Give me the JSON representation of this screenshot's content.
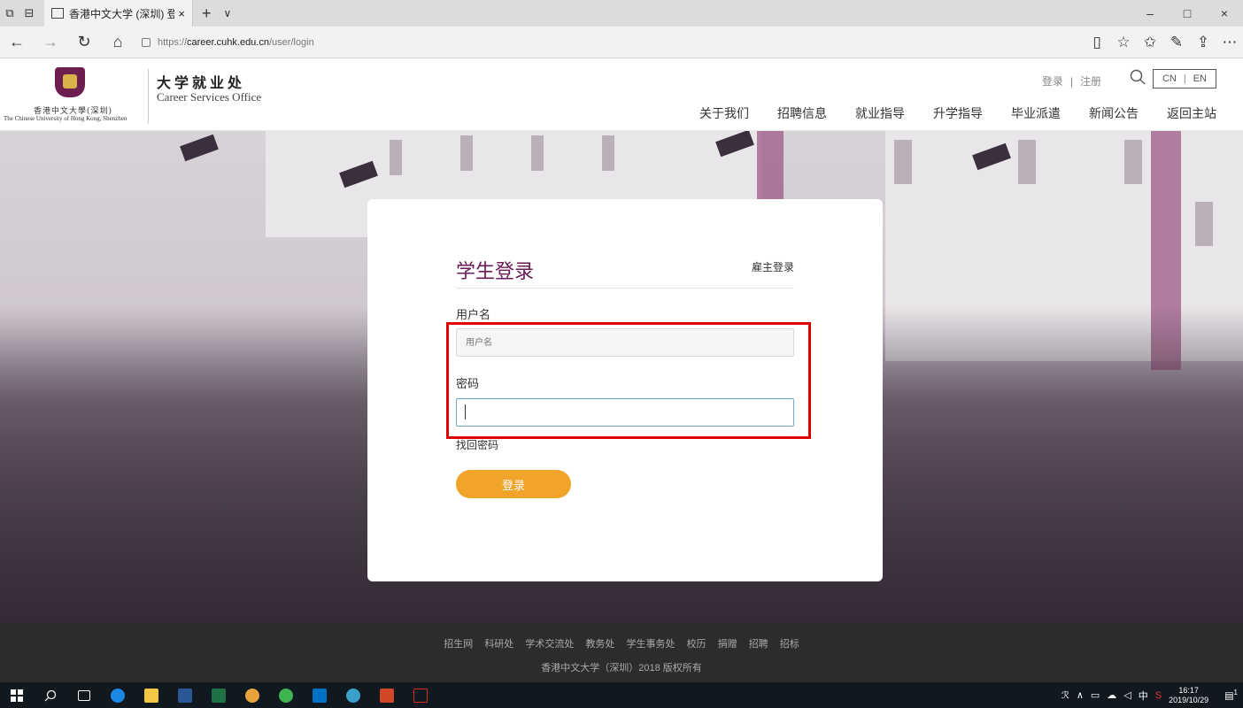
{
  "browser": {
    "tab_title": "香港中文大学 (深圳) 登录",
    "tab_close": "×",
    "new_tab": "+",
    "tab_list": "∨",
    "url_prefix": "https://",
    "url_host": "career.cuhk.edu.cn",
    "url_path": "/user/login",
    "window_minimize": "–",
    "window_restore": "□",
    "window_close": "×"
  },
  "site": {
    "logo_cn": "香港中文大學(深圳)",
    "logo_en": "The Chinese University of Hong Kong, Shenzhen",
    "office_cn": "大学就业处",
    "office_en": "Career Services Office",
    "login_link": "登录",
    "register_link": "注册",
    "utility_sep": "|",
    "lang_cn": "CN",
    "lang_en": "EN",
    "lang_sep": "|",
    "nav": [
      "关于我们",
      "招聘信息",
      "就业指导",
      "升学指导",
      "毕业派遣",
      "新闻公告",
      "返回主站"
    ]
  },
  "login": {
    "title": "学生登录",
    "employer_login": "雇主登录",
    "username_label": "用户名",
    "username_placeholder": "用户名",
    "password_label": "密码",
    "password_value": "",
    "forgot_password": "找回密码",
    "submit": "登录"
  },
  "footer": {
    "links": [
      "招生网",
      "科研处",
      "学术交流处",
      "教务处",
      "学生事务处",
      "校历",
      "捐赠",
      "招聘",
      "招标"
    ],
    "copyright": "香港中文大学（深圳）2018 版权所有"
  },
  "taskbar": {
    "time": "16:17",
    "date": "2019/10/29",
    "ime": "中",
    "notification_count": "1"
  },
  "colors": {
    "brand_purple": "#6a1b56",
    "login_button": "#f0a42a",
    "highlight": "#e00000",
    "footer_bg": "#2c2c2c"
  }
}
